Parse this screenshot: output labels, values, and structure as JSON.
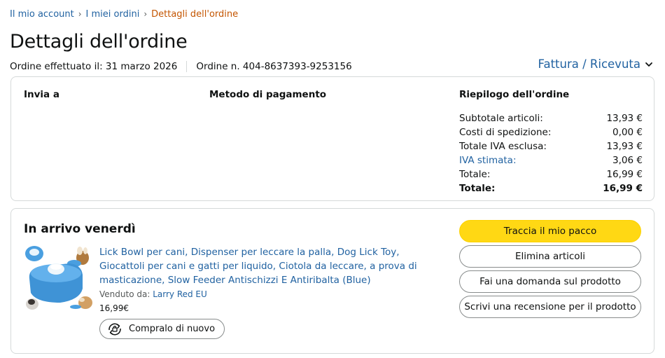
{
  "breadcrumb": {
    "items": [
      "Il mio account",
      "I miei ordini"
    ],
    "current": "Dettagli dell'ordine"
  },
  "page_title": "Dettagli dell'ordine",
  "order_meta": {
    "placed": "Ordine effettuato il: 31 marzo 2026",
    "number": "Ordine n. 404-8637393-9253156"
  },
  "invoice_link": "Fattura / Ricevuta",
  "details": {
    "ship_to_title": "Invia a",
    "payment_title": "Metodo di pagamento",
    "summary_title": "Riepilogo dell'ordine",
    "rows": [
      {
        "label": "Subtotale articoli:",
        "value": "13,93 €"
      },
      {
        "label": "Costi di spedizione:",
        "value": "0,00 €"
      },
      {
        "label": "Totale IVA esclusa:",
        "value": "13,93 €"
      },
      {
        "label": "IVA stimata:",
        "value": "3,06 €"
      },
      {
        "label": "Totale:",
        "value": "16,99 €"
      },
      {
        "label": "Totale:",
        "value": "16,99 €"
      }
    ]
  },
  "shipment": {
    "status": "In arrivo venerdì",
    "product_title": "Lick Bowl per cani, Dispenser per leccare la palla, Dog Lick Toy, Giocattoli per cani e gatti per liquido, Ciotola da leccare, a prova di masticazione, Slow Feeder Antischizzi E Antiribalta (Blue)",
    "sold_by_label": "Venduto da:",
    "seller": "Larry Red EU",
    "price": "16,99€",
    "buy_again": "Compralo di nuovo",
    "buttons": {
      "track": "Traccia il mio pacco",
      "delete": "Elimina articoli",
      "ask": "Fai una domanda sul prodotto",
      "review": "Scrivi una recensione per il prodotto"
    }
  },
  "colors": {
    "link": "#2162a1",
    "breadcrumb_current": "#c45500",
    "primary_button": "#ffd814",
    "border": "#d5d9d9",
    "product_blue": "#4a9fe0"
  },
  "icons": [
    "chevron-down-icon",
    "buy-again-icon"
  ]
}
